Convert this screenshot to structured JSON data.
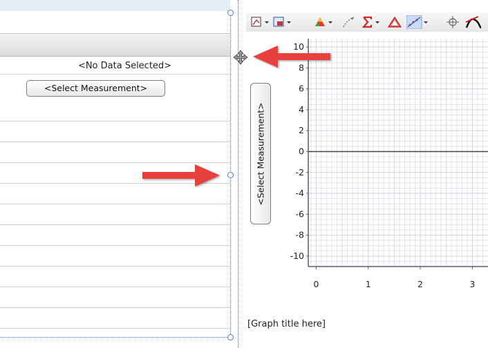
{
  "table": {
    "no_data_label": "<No Data Selected>",
    "select_measurement_label": "<Select Measurement>"
  },
  "graph": {
    "y_axis_button_label": "<Select Measurement>",
    "title_placeholder": "[Graph title here]",
    "y_ticks": [
      "10",
      "8",
      "6",
      "4",
      "2",
      "0",
      "-2",
      "-4",
      "-6",
      "-8",
      "-10"
    ],
    "x_ticks": [
      "0",
      "1",
      "2",
      "3"
    ]
  },
  "toolbar": {
    "icons": [
      "graph-options-icon",
      "zoom-icon",
      "color-icon",
      "draw-icon",
      "sigma-statistics-icon",
      "triangle-icon",
      "curve-fit-icon",
      "crosshair-icon",
      "tangent-icon"
    ]
  },
  "colors": {
    "arrow": "#e8403c",
    "selection": "#4a78d8",
    "grid": "#e3e3ec",
    "axis": "#444444"
  },
  "chart_data": {
    "type": "line",
    "x_range": [
      -0.15,
      3.3
    ],
    "y_range": [
      -11,
      10.8
    ],
    "x_ticks": [
      0,
      1,
      2,
      3
    ],
    "y_ticks": [
      10,
      8,
      6,
      4,
      2,
      0,
      -2,
      -4,
      -6,
      -8,
      -10
    ],
    "grid": true,
    "series": []
  }
}
